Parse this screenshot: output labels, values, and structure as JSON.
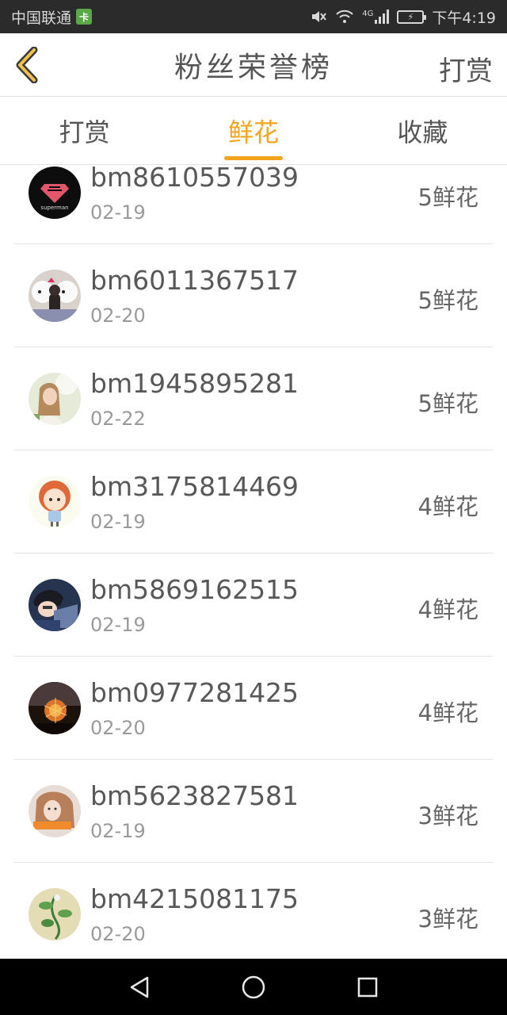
{
  "status_bar": {
    "carrier": "中国联通",
    "carrier_badge_icon": "sim-badge-icon",
    "network": "4G",
    "time": "下午4:19"
  },
  "header": {
    "title": "粉丝荣誉榜",
    "action_label": "打赏",
    "back_icon": "chevron-left-icon",
    "accent_color": "#f1a41c"
  },
  "tabs": [
    {
      "label": "打赏",
      "active": false
    },
    {
      "label": "鲜花",
      "active": true
    },
    {
      "label": "收藏",
      "active": false
    }
  ],
  "fans": [
    {
      "username": "bm8610557039",
      "date": "02-19",
      "amount": "5鲜花",
      "avatar": "superman-logo-avatar"
    },
    {
      "username": "bm6011367517",
      "date": "02-20",
      "amount": "5鲜花",
      "avatar": "hello-kitty-avatar"
    },
    {
      "username": "bm1945895281",
      "date": "02-22",
      "amount": "5鲜花",
      "avatar": "girl-photo-avatar"
    },
    {
      "username": "bm3175814469",
      "date": "02-19",
      "amount": "4鲜花",
      "avatar": "cartoon-girl-avatar"
    },
    {
      "username": "bm5869162515",
      "date": "02-19",
      "amount": "4鲜花",
      "avatar": "anime-boy-avatar"
    },
    {
      "username": "bm0977281425",
      "date": "02-20",
      "amount": "4鲜花",
      "avatar": "dandelion-sunset-avatar"
    },
    {
      "username": "bm5623827581",
      "date": "02-19",
      "amount": "3鲜花",
      "avatar": "girl-portrait-avatar"
    },
    {
      "username": "bm4215081175",
      "date": "02-20",
      "amount": "3鲜花",
      "avatar": "green-plant-drawing-avatar"
    }
  ],
  "nav_bar": {
    "back_icon": "triangle-back-icon",
    "home_icon": "circle-home-icon",
    "recents_icon": "square-recents-icon"
  }
}
